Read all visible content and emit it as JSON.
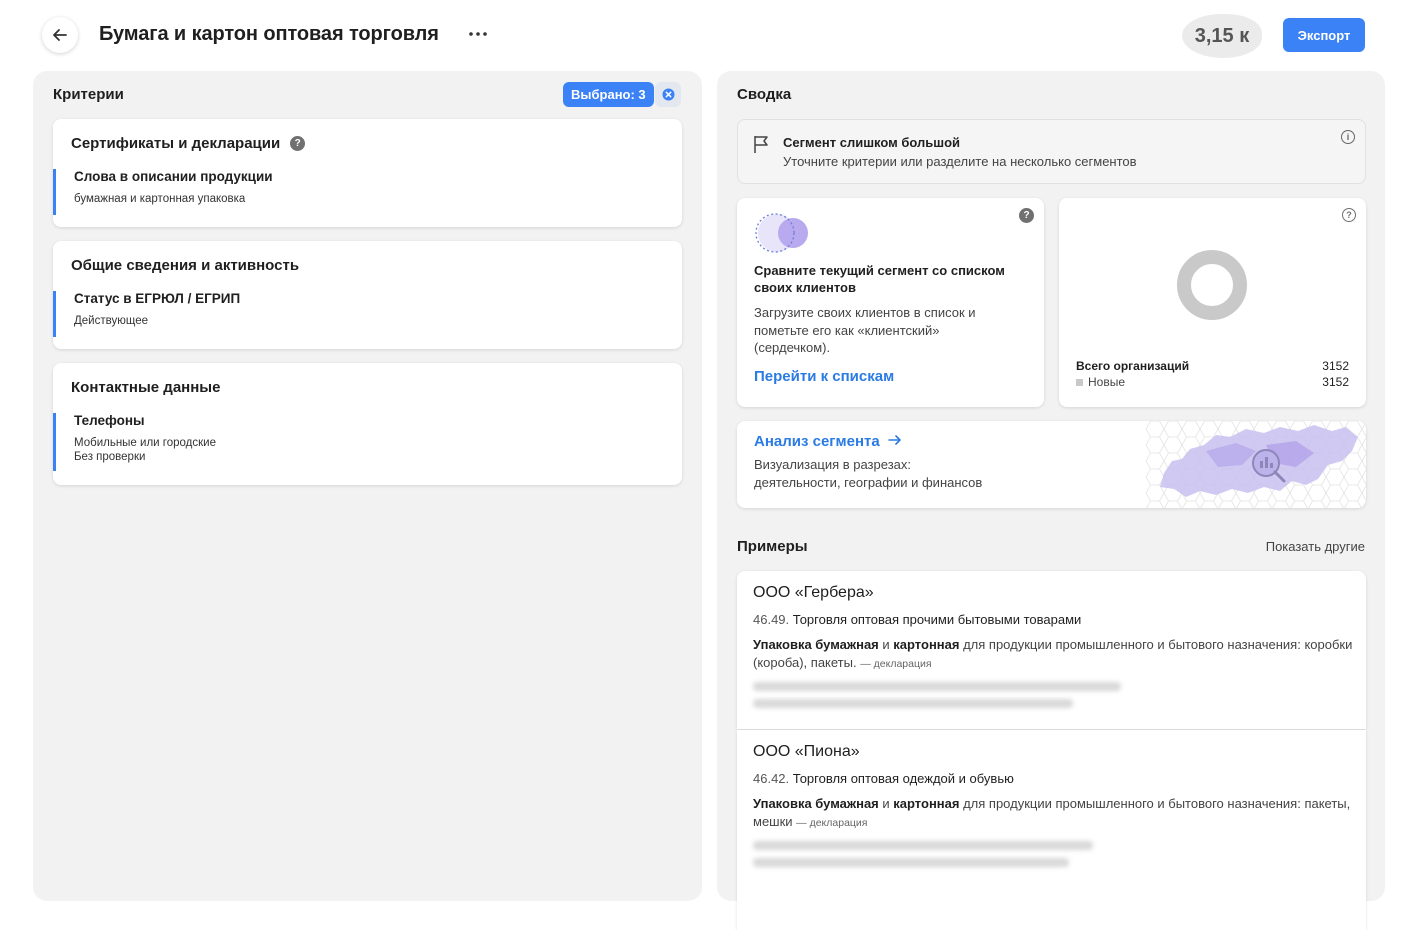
{
  "header": {
    "title": "Бумага и картон оптовая торговля",
    "count": "3,15 к",
    "export_label": "Экспорт"
  },
  "criteria": {
    "title": "Критерии",
    "selected_label": "Выбрано: 3",
    "cards": [
      {
        "title": "Сертификаты и декларации",
        "item_title": "Слова в описании продукции",
        "item_lines": [
          "бумажная и картонная упаковка"
        ]
      },
      {
        "title": "Общие сведения и активность",
        "item_title": "Статус в ЕГРЮЛ / ЕГРИП",
        "item_lines": [
          "Действующее"
        ]
      },
      {
        "title": "Контактные данные",
        "item_title": "Телефоны",
        "item_lines": [
          "Мобильные или городские",
          "Без проверки"
        ]
      }
    ]
  },
  "summary": {
    "title": "Сводка",
    "warning": {
      "title": "Сегмент слишком большой",
      "subtitle": "Уточните критерии или разделите на несколько сегментов"
    },
    "compare": {
      "title": "Сравните текущий сегмент со списком своих клиентов",
      "text": "Загрузите своих клиентов в список и пометьте его как «клиентский» (сердечком).",
      "link": "Перейти к спискам"
    },
    "stats": {
      "total_label": "Всего организаций",
      "total_value": "3152",
      "new_label": "Новые",
      "new_value": "3152",
      "donut_color": "#c9c9c9",
      "new_fraction": 1.0
    },
    "analysis": {
      "title": "Анализ сегмента",
      "text_line1": "Визуализация в разрезах:",
      "text_line2": "деятельности, географии и финансов"
    }
  },
  "examples": {
    "title": "Примеры",
    "show_more": "Показать другие",
    "items": [
      {
        "name": "ООО «Гербера»",
        "okved_code": "46.49.",
        "okved_text": "Торговля оптовая прочими бытовыми товарами",
        "desc_b1": "Упаковка бумажная",
        "desc_and": "и",
        "desc_b2": "картонная",
        "desc_rest": "для продукции промышленного и бытового назначения: коробки (короба), пакеты.",
        "tag": "— декларация"
      },
      {
        "name": "ООО «Пиона»",
        "okved_code": "46.42.",
        "okved_text": "Торговля оптовая одеждой и обувью",
        "desc_b1": "Упаковка бумажная",
        "desc_and": "и",
        "desc_b2": "картонная",
        "desc_rest": "для продукции промышленного и бытового назначения: пакеты, мешки",
        "tag": "— декларация"
      }
    ]
  },
  "colors": {
    "accent": "#3b82f6",
    "link": "#2b7be4",
    "panel_bg": "#f2f2f2"
  }
}
